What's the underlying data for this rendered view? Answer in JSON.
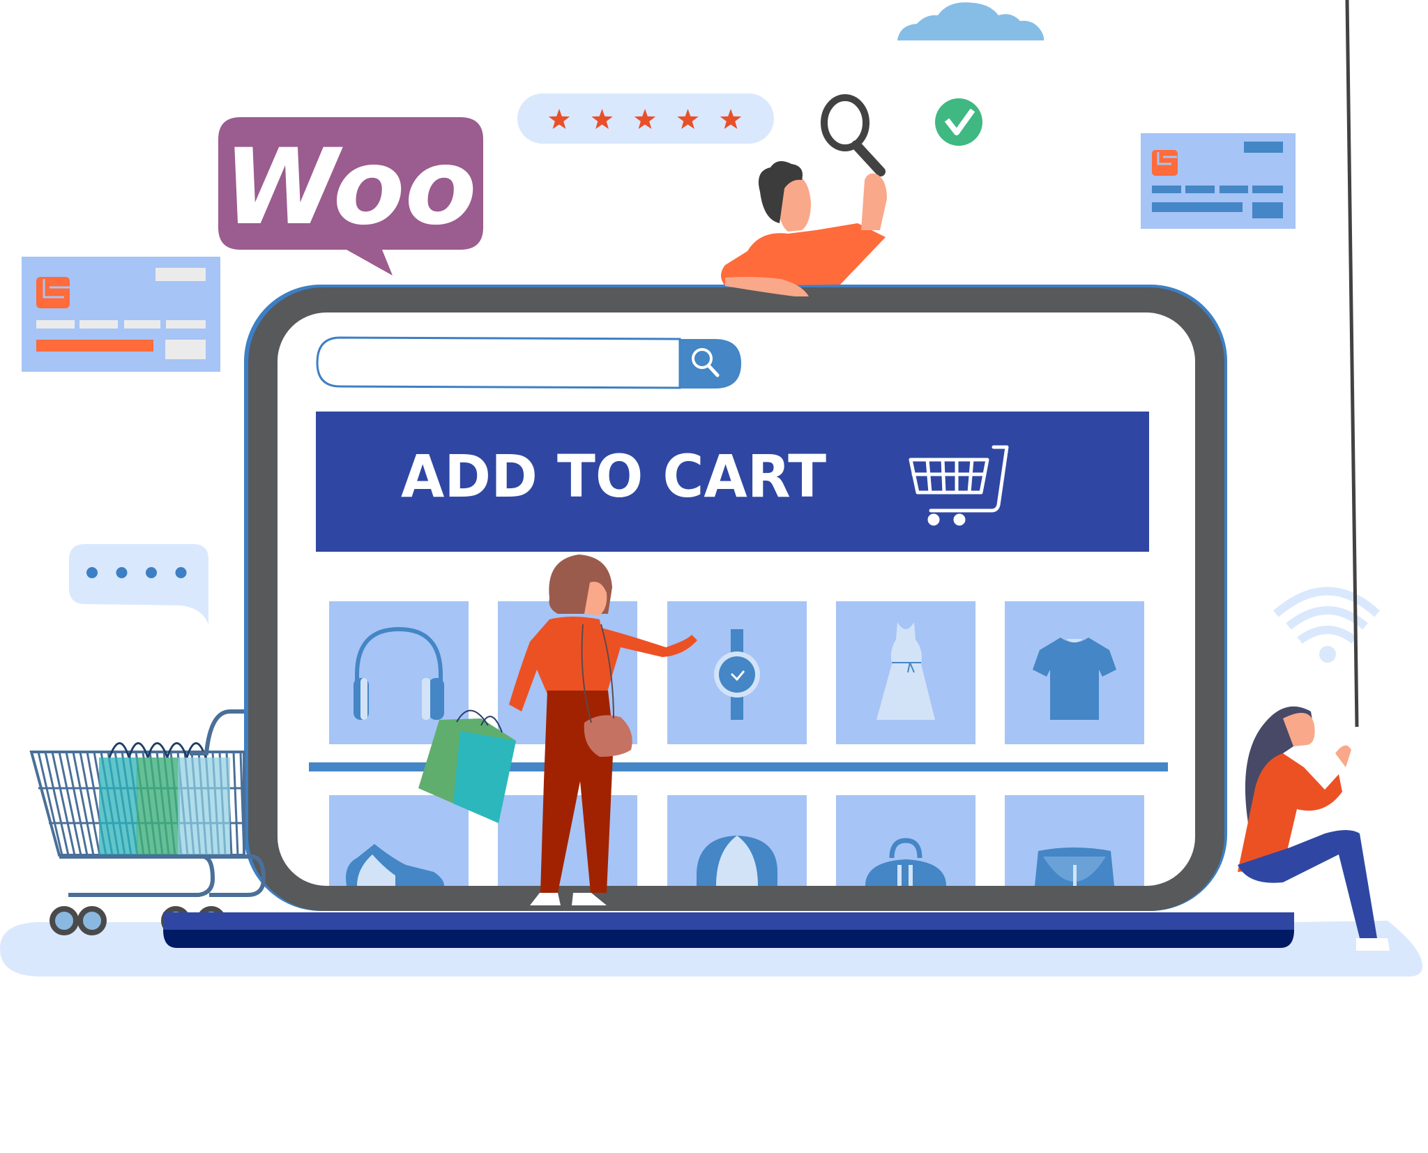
{
  "brand": {
    "logo_text": "Woo",
    "logo_color": "#9b5c8f"
  },
  "search": {
    "value": "",
    "placeholder": "",
    "button_icon": "search-icon"
  },
  "banner": {
    "label": "ADD TO CART",
    "icon": "shopping-cart-icon",
    "background": "#2f47a3"
  },
  "rating": {
    "stars": 5,
    "max": 5,
    "star_color": "#e8502a"
  },
  "status": {
    "verified_icon": "check-circle-icon",
    "verified_color": "#3fb882"
  },
  "chat_bubble": {
    "dots": 4
  },
  "products": {
    "row1": [
      {
        "name": "Headphones",
        "icon": "headphones-icon"
      },
      {
        "name": "Product",
        "icon": "hidden-product-icon"
      },
      {
        "name": "Wristwatch",
        "icon": "watch-icon"
      },
      {
        "name": "Dress",
        "icon": "dress-icon"
      },
      {
        "name": "T-Shirt",
        "icon": "tshirt-icon"
      }
    ],
    "row2": [
      {
        "name": "Sneaker",
        "icon": "shoe-icon"
      },
      {
        "name": "Product",
        "icon": "hidden-product-icon"
      },
      {
        "name": "Cap",
        "icon": "cap-icon"
      },
      {
        "name": "Bag",
        "icon": "bag-icon"
      },
      {
        "name": "Skirt",
        "icon": "skirt-icon"
      }
    ]
  },
  "colors": {
    "frame": "#58595b",
    "frame_accent": "#3d7fc4",
    "tile": "#a6c4f5",
    "item_blue": "#4486c6",
    "item_light": "#d2e3f8",
    "orange": "#ff6b3a",
    "floor": "#dae8fd"
  }
}
